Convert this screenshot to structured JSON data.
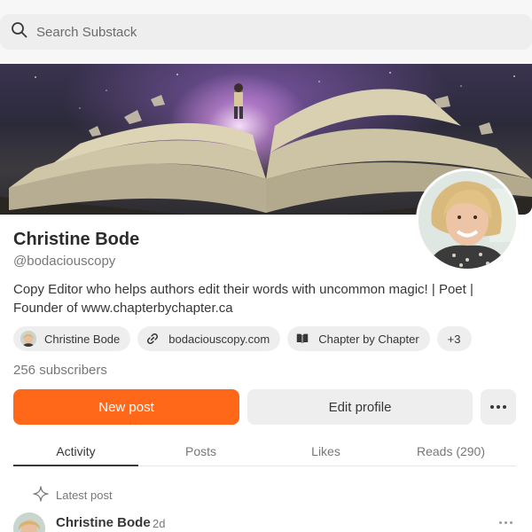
{
  "search": {
    "placeholder": "Search Substack"
  },
  "profile": {
    "name": "Christine Bode",
    "handle": "@bodaciouscopy",
    "bio": "Copy Editor who helps authors edit their words with uncommon magic! | Poet | Founder of www.chapterbychapter.ca",
    "subscribers": "256 subscribers"
  },
  "chips": [
    {
      "label": "Christine Bode",
      "icon": "avatar-icon"
    },
    {
      "label": "bodaciouscopy.com",
      "icon": "link-icon"
    },
    {
      "label": "Chapter by Chapter",
      "icon": "book-icon"
    },
    {
      "label": "+3"
    }
  ],
  "actions": {
    "new_post": "New post",
    "edit_profile": "Edit profile",
    "more": "more-options-icon"
  },
  "tabs": [
    {
      "label": "Activity",
      "active": true
    },
    {
      "label": "Posts"
    },
    {
      "label": "Likes"
    },
    {
      "label": "Reads (290)"
    }
  ],
  "feed": {
    "section_label": "Latest post",
    "author": "Christine Bode",
    "time": "2d"
  },
  "colors": {
    "accent": "#ff6719",
    "text": "#363737",
    "muted": "#777777"
  }
}
